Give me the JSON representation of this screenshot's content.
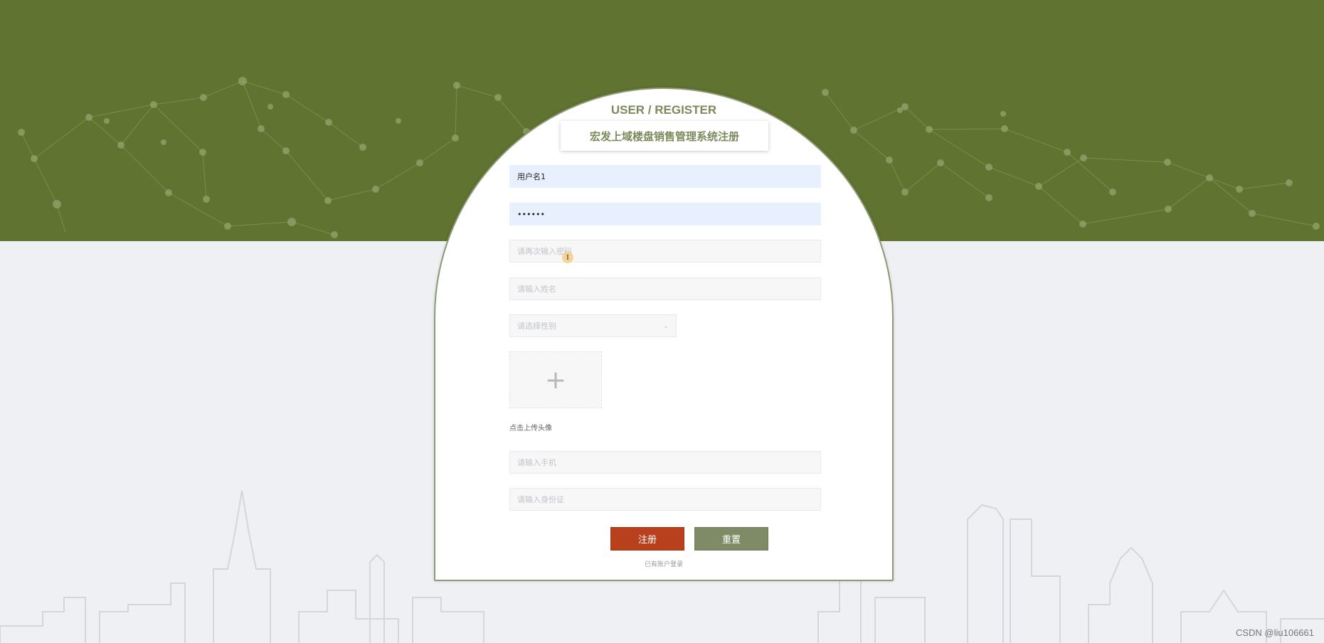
{
  "header": {
    "subtitle": "USER / REGISTER",
    "title": "宏发上域楼盘销售管理系统注册"
  },
  "form": {
    "username": {
      "value": "用户名1",
      "placeholder": ""
    },
    "password": {
      "value": "••••••",
      "placeholder": ""
    },
    "confirm_password": {
      "value": "",
      "placeholder": "请再次输入密码"
    },
    "name": {
      "value": "",
      "placeholder": "请输入姓名"
    },
    "gender": {
      "selected": "请选择性别"
    },
    "avatar": {
      "plus": "+",
      "label": "点击上传头像"
    },
    "phone": {
      "value": "",
      "placeholder": "请输入手机"
    },
    "id_card": {
      "value": "",
      "placeholder": "请输入身份证"
    }
  },
  "buttons": {
    "register": "注册",
    "reset": "重置"
  },
  "login_link": "已有账户登录",
  "cursor": "I",
  "watermark": "CSDN @liu106661",
  "colors": {
    "header_green": "#607330",
    "register_red": "#b8401d",
    "reset_green": "#7e8b66",
    "title_green": "#7c8a5c"
  }
}
